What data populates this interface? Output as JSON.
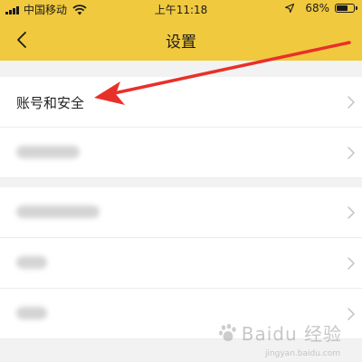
{
  "status_bar": {
    "carrier": "中国移动",
    "time": "上午11:18",
    "battery_percent_text": "68%",
    "battery_level": 0.68
  },
  "header": {
    "title": "设置",
    "back_icon": "chevron-left-icon"
  },
  "settings": {
    "items": [
      {
        "label": "账号和安全",
        "chevron_icon": "chevron-right-icon"
      }
    ]
  },
  "watermark": {
    "text": "Baidu 经验",
    "sub": "jingyan.baidu.com"
  },
  "colors": {
    "header_bg": "#f0c93f",
    "annotation_arrow": "#e8302a",
    "page_bg": "#f2f2f2",
    "row_bg": "#ffffff"
  }
}
